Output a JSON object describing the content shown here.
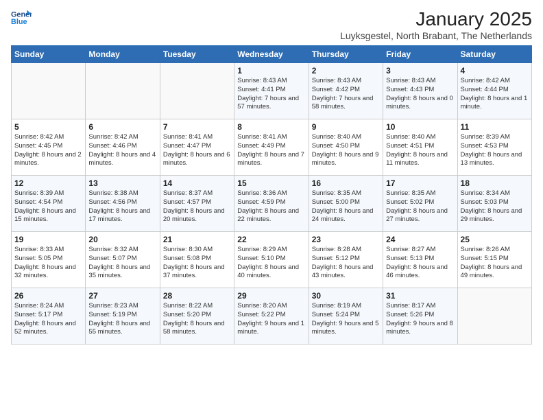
{
  "header": {
    "logo_line1": "General",
    "logo_line2": "Blue",
    "month_year": "January 2025",
    "location": "Luyksgestel, North Brabant, The Netherlands"
  },
  "weekdays": [
    "Sunday",
    "Monday",
    "Tuesday",
    "Wednesday",
    "Thursday",
    "Friday",
    "Saturday"
  ],
  "weeks": [
    [
      {
        "day": "",
        "text": ""
      },
      {
        "day": "",
        "text": ""
      },
      {
        "day": "",
        "text": ""
      },
      {
        "day": "1",
        "text": "Sunrise: 8:43 AM\nSunset: 4:41 PM\nDaylight: 7 hours\nand 57 minutes."
      },
      {
        "day": "2",
        "text": "Sunrise: 8:43 AM\nSunset: 4:42 PM\nDaylight: 7 hours\nand 58 minutes."
      },
      {
        "day": "3",
        "text": "Sunrise: 8:43 AM\nSunset: 4:43 PM\nDaylight: 8 hours\nand 0 minutes."
      },
      {
        "day": "4",
        "text": "Sunrise: 8:42 AM\nSunset: 4:44 PM\nDaylight: 8 hours\nand 1 minute."
      }
    ],
    [
      {
        "day": "5",
        "text": "Sunrise: 8:42 AM\nSunset: 4:45 PM\nDaylight: 8 hours\nand 2 minutes."
      },
      {
        "day": "6",
        "text": "Sunrise: 8:42 AM\nSunset: 4:46 PM\nDaylight: 8 hours\nand 4 minutes."
      },
      {
        "day": "7",
        "text": "Sunrise: 8:41 AM\nSunset: 4:47 PM\nDaylight: 8 hours\nand 6 minutes."
      },
      {
        "day": "8",
        "text": "Sunrise: 8:41 AM\nSunset: 4:49 PM\nDaylight: 8 hours\nand 7 minutes."
      },
      {
        "day": "9",
        "text": "Sunrise: 8:40 AM\nSunset: 4:50 PM\nDaylight: 8 hours\nand 9 minutes."
      },
      {
        "day": "10",
        "text": "Sunrise: 8:40 AM\nSunset: 4:51 PM\nDaylight: 8 hours\nand 11 minutes."
      },
      {
        "day": "11",
        "text": "Sunrise: 8:39 AM\nSunset: 4:53 PM\nDaylight: 8 hours\nand 13 minutes."
      }
    ],
    [
      {
        "day": "12",
        "text": "Sunrise: 8:39 AM\nSunset: 4:54 PM\nDaylight: 8 hours\nand 15 minutes."
      },
      {
        "day": "13",
        "text": "Sunrise: 8:38 AM\nSunset: 4:56 PM\nDaylight: 8 hours\nand 17 minutes."
      },
      {
        "day": "14",
        "text": "Sunrise: 8:37 AM\nSunset: 4:57 PM\nDaylight: 8 hours\nand 20 minutes."
      },
      {
        "day": "15",
        "text": "Sunrise: 8:36 AM\nSunset: 4:59 PM\nDaylight: 8 hours\nand 22 minutes."
      },
      {
        "day": "16",
        "text": "Sunrise: 8:35 AM\nSunset: 5:00 PM\nDaylight: 8 hours\nand 24 minutes."
      },
      {
        "day": "17",
        "text": "Sunrise: 8:35 AM\nSunset: 5:02 PM\nDaylight: 8 hours\nand 27 minutes."
      },
      {
        "day": "18",
        "text": "Sunrise: 8:34 AM\nSunset: 5:03 PM\nDaylight: 8 hours\nand 29 minutes."
      }
    ],
    [
      {
        "day": "19",
        "text": "Sunrise: 8:33 AM\nSunset: 5:05 PM\nDaylight: 8 hours\nand 32 minutes."
      },
      {
        "day": "20",
        "text": "Sunrise: 8:32 AM\nSunset: 5:07 PM\nDaylight: 8 hours\nand 35 minutes."
      },
      {
        "day": "21",
        "text": "Sunrise: 8:30 AM\nSunset: 5:08 PM\nDaylight: 8 hours\nand 37 minutes."
      },
      {
        "day": "22",
        "text": "Sunrise: 8:29 AM\nSunset: 5:10 PM\nDaylight: 8 hours\nand 40 minutes."
      },
      {
        "day": "23",
        "text": "Sunrise: 8:28 AM\nSunset: 5:12 PM\nDaylight: 8 hours\nand 43 minutes."
      },
      {
        "day": "24",
        "text": "Sunrise: 8:27 AM\nSunset: 5:13 PM\nDaylight: 8 hours\nand 46 minutes."
      },
      {
        "day": "25",
        "text": "Sunrise: 8:26 AM\nSunset: 5:15 PM\nDaylight: 8 hours\nand 49 minutes."
      }
    ],
    [
      {
        "day": "26",
        "text": "Sunrise: 8:24 AM\nSunset: 5:17 PM\nDaylight: 8 hours\nand 52 minutes."
      },
      {
        "day": "27",
        "text": "Sunrise: 8:23 AM\nSunset: 5:19 PM\nDaylight: 8 hours\nand 55 minutes."
      },
      {
        "day": "28",
        "text": "Sunrise: 8:22 AM\nSunset: 5:20 PM\nDaylight: 8 hours\nand 58 minutes."
      },
      {
        "day": "29",
        "text": "Sunrise: 8:20 AM\nSunset: 5:22 PM\nDaylight: 9 hours\nand 1 minute."
      },
      {
        "day": "30",
        "text": "Sunrise: 8:19 AM\nSunset: 5:24 PM\nDaylight: 9 hours\nand 5 minutes."
      },
      {
        "day": "31",
        "text": "Sunrise: 8:17 AM\nSunset: 5:26 PM\nDaylight: 9 hours\nand 8 minutes."
      },
      {
        "day": "",
        "text": ""
      }
    ]
  ]
}
